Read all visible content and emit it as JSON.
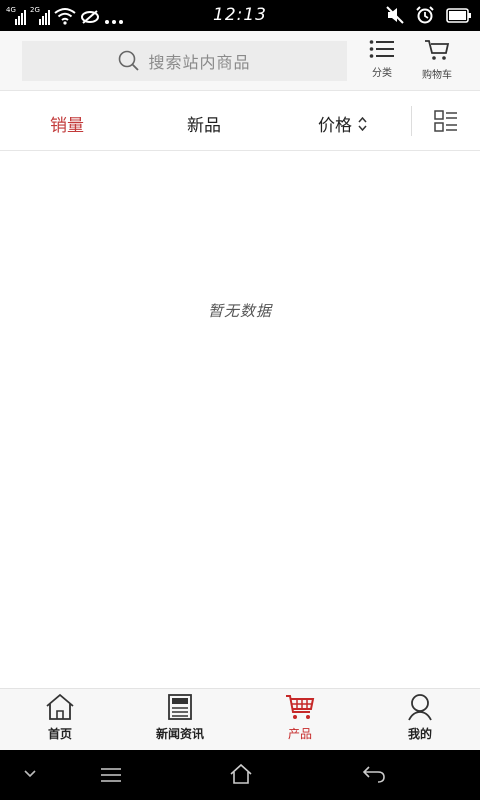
{
  "status_bar": {
    "sim1_label": "4G",
    "sim2_label": "2G",
    "time": "12:13"
  },
  "header": {
    "search_placeholder": "搜索站内商品",
    "category_label": "分类",
    "cart_label": "购物车"
  },
  "sort_bar": {
    "sales_label": "销量",
    "new_label": "新品",
    "price_label": "价格",
    "active": "sales"
  },
  "content": {
    "empty_text": "暂无数据"
  },
  "tab_bar": {
    "tabs": [
      {
        "label": "首页",
        "icon": "home-icon"
      },
      {
        "label": "新闻资讯",
        "icon": "news-icon"
      },
      {
        "label": "产品",
        "icon": "cart-icon"
      },
      {
        "label": "我的",
        "icon": "user-icon"
      }
    ],
    "active_index": 2
  },
  "colors": {
    "accent": "#c62828",
    "header_bg": "#f7f7f7",
    "search_bg": "#ececec"
  }
}
